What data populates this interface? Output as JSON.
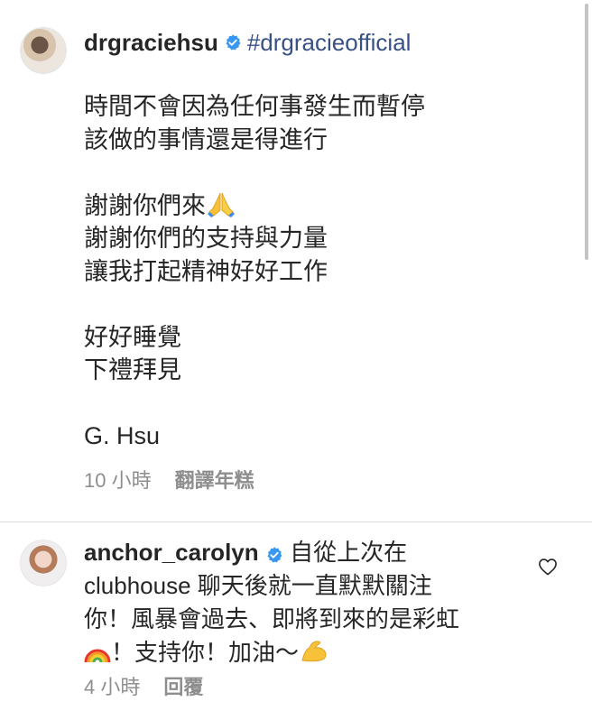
{
  "post": {
    "username": "drgraciehsu",
    "hashtag": "#drgracieofficial",
    "caption_lines": [
      "時間不會因為任何事發生而暫停",
      "該做的事情還是得進行",
      "",
      "謝謝你們來",
      "謝謝你們的支持與力量",
      "讓我打起精神好好工作",
      "",
      "好好睡覺",
      "下禮拜見",
      "",
      "G. Hsu"
    ],
    "time": "10 小時",
    "translate_label": "翻譯年糕"
  },
  "comment": {
    "username": "anchor_carolyn",
    "line1": "自從上次在",
    "line2": "clubhouse 聊天後就一直默默關注",
    "line3": "你！風暴會過去、即將到來的是彩虹",
    "line4": "！支持你！加油～",
    "time": "4 小時",
    "reply_label": "回覆"
  },
  "icons": {
    "verified": "verified-badge-icon",
    "pray": "folded-hands-emoji",
    "rainbow": "rainbow-emoji",
    "muscle": "flexed-biceps-emoji",
    "heart": "heart-outline-icon"
  },
  "colors": {
    "text": "#262626",
    "muted": "#8e8e8e",
    "verified": "#3897f0",
    "hashtag": "#385185"
  }
}
